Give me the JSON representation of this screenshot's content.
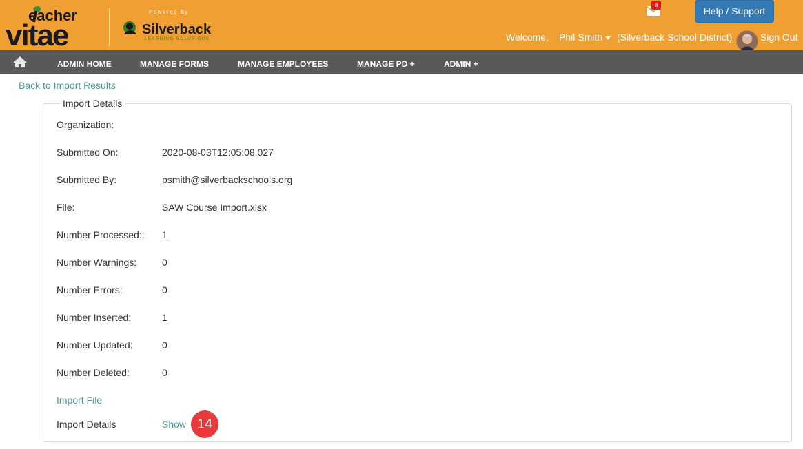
{
  "header": {
    "logo_text": "Teacher Vitae",
    "powered_by": "Powered By",
    "partner_name": "Silverback",
    "partner_tagline": "LEARNING SOLUTIONS",
    "mail_count": "8",
    "help_label": "Help / Support",
    "welcome": "Welcome,",
    "user_name": "Phil Smith",
    "district": "(Silverback School District)",
    "sign_out": "Sign Out",
    "colors": {
      "bar": "#f0a033",
      "help_button": "#337ab7",
      "badge": "#e02020"
    }
  },
  "nav": {
    "home_icon": "home-icon",
    "items": [
      {
        "label": "ADMIN HOME"
      },
      {
        "label": "MANAGE FORMS"
      },
      {
        "label": "MANAGE EMPLOYEES"
      },
      {
        "label": "MANAGE PD +"
      },
      {
        "label": "ADMIN +"
      }
    ]
  },
  "main": {
    "back_link": "Back to Import Results",
    "panel_title": "Import Details",
    "rows": [
      {
        "label": "Organization:",
        "value": ""
      },
      {
        "label": "Submitted On:",
        "value": "2020-08-03T12:05:08.027"
      },
      {
        "label": "Submitted By:",
        "value": "psmith@silverbackschools.org"
      },
      {
        "label": "File:",
        "value": "SAW Course Import.xlsx"
      },
      {
        "label": "Number Processed::",
        "value": "1"
      },
      {
        "label": "Number Warnings:",
        "value": "0"
      },
      {
        "label": "Number Errors:",
        "value": "0"
      },
      {
        "label": "Number Inserted:",
        "value": "1"
      },
      {
        "label": "Number Updated:",
        "value": "0"
      },
      {
        "label": "Number Deleted:",
        "value": "0"
      }
    ],
    "import_file_link": "Import File",
    "import_details_label": "Import Details",
    "show_link": "Show",
    "step_badge": "14",
    "link_color": "#4b9a95"
  }
}
